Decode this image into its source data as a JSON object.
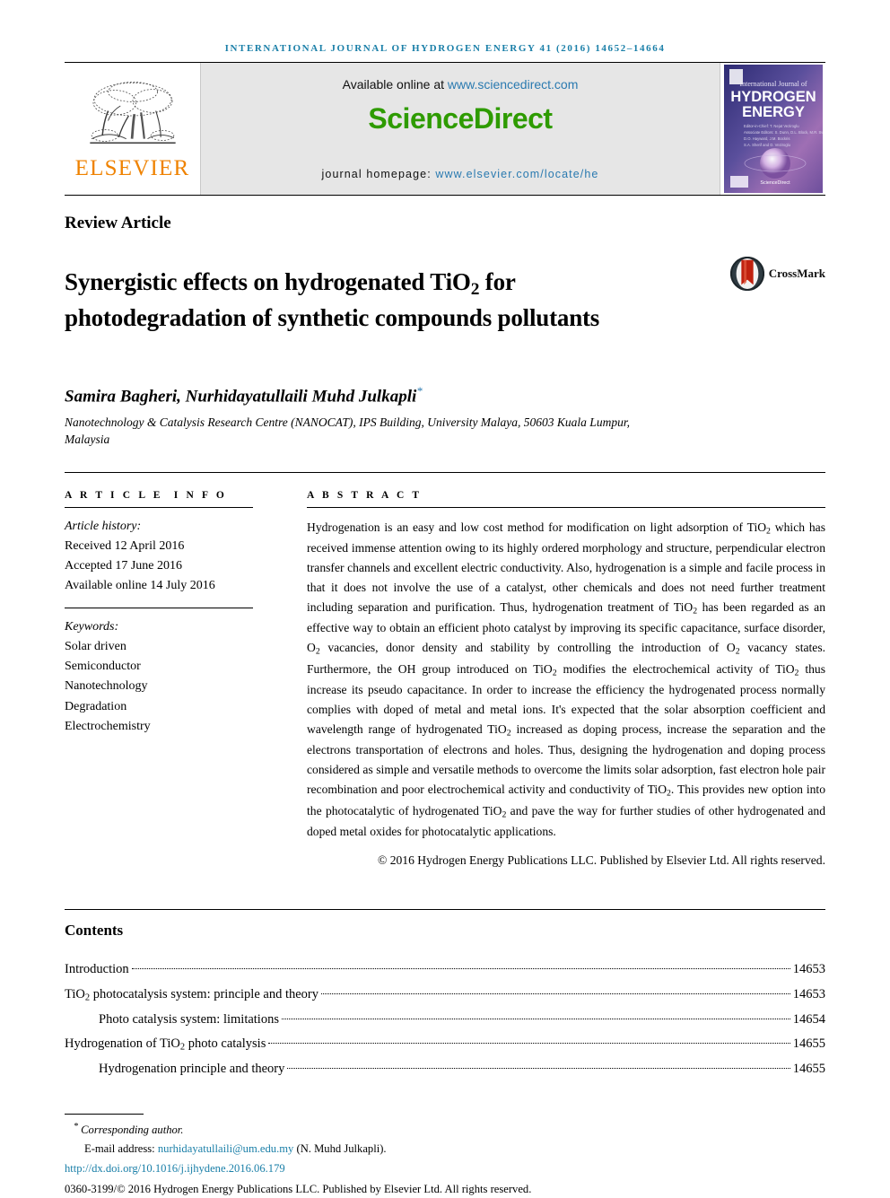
{
  "running_head": "International Journal of Hydrogen Energy 41 (2016) 14652–14664",
  "masthead": {
    "publisher_name": "ELSEVIER",
    "available_prefix": "Available online at ",
    "available_url": "www.sciencedirect.com",
    "sciencedirect_logo": "ScienceDirect",
    "homepage_label": "journal homepage: ",
    "homepage_url": "www.elsevier.com/locate/he",
    "cover_line1": "International Journal of",
    "cover_line2": "HYDROGEN",
    "cover_line3": "ENERGY",
    "cover_footer": "ScienceDirect"
  },
  "article": {
    "type": "Review Article",
    "title": "Synergistic effects on hydrogenated TiO2 for photodegradation of synthetic compounds pollutants",
    "crossmark_label": "CrossMark",
    "authors": "Samira Bagheri, Nurhidayatullaili Muhd Julkapli",
    "author_star": "*",
    "affiliation": "Nanotechnology & Catalysis Research Centre (NANOCAT), IPS Building, University Malaya, 50603 Kuala Lumpur, Malaysia"
  },
  "article_info": {
    "heading": "ARTICLE INFO",
    "history_label": "Article history:",
    "history": [
      "Received 12 April 2016",
      "Accepted 17 June 2016",
      "Available online 14 July 2016"
    ],
    "keywords_label": "Keywords:",
    "keywords": [
      "Solar driven",
      "Semiconductor",
      "Nanotechnology",
      "Degradation",
      "Electrochemistry"
    ]
  },
  "abstract": {
    "heading": "ABSTRACT",
    "copyright": "© 2016 Hydrogen Energy Publications LLC. Published by Elsevier Ltd. All rights reserved."
  },
  "contents": {
    "heading": "Contents",
    "entries": [
      {
        "label": "Introduction",
        "page": "14653",
        "indent": false
      },
      {
        "label": "TiO2 photocatalysis system: principle and theory",
        "page": "14653",
        "indent": false
      },
      {
        "label": "Photo catalysis system: limitations",
        "page": "14654",
        "indent": true
      },
      {
        "label": "Hydrogenation of TiO2 photo catalysis",
        "page": "14655",
        "indent": false
      },
      {
        "label": "Hydrogenation principle and theory",
        "page": "14655",
        "indent": true
      }
    ]
  },
  "footer": {
    "corresponding": "Corresponding author.",
    "corresponding_star": "*",
    "email_label": "E-mail address:",
    "email": "nurhidayatullaili@um.edu.my",
    "email_suffix": "(N. Muhd Julkapli).",
    "doi": "http://dx.doi.org/10.1016/j.ijhydene.2016.06.179",
    "issn_line": "0360-3199/© 2016 Hydrogen Energy Publications LLC. Published by Elsevier Ltd. All rights reserved."
  },
  "colors": {
    "running_head": "#1a7fa8",
    "link": "#1a7fa8",
    "sciencedirect_green": "#2e9b00",
    "elsevier_orange": "#ef8200",
    "banner_grey": "#e6e6e6"
  }
}
